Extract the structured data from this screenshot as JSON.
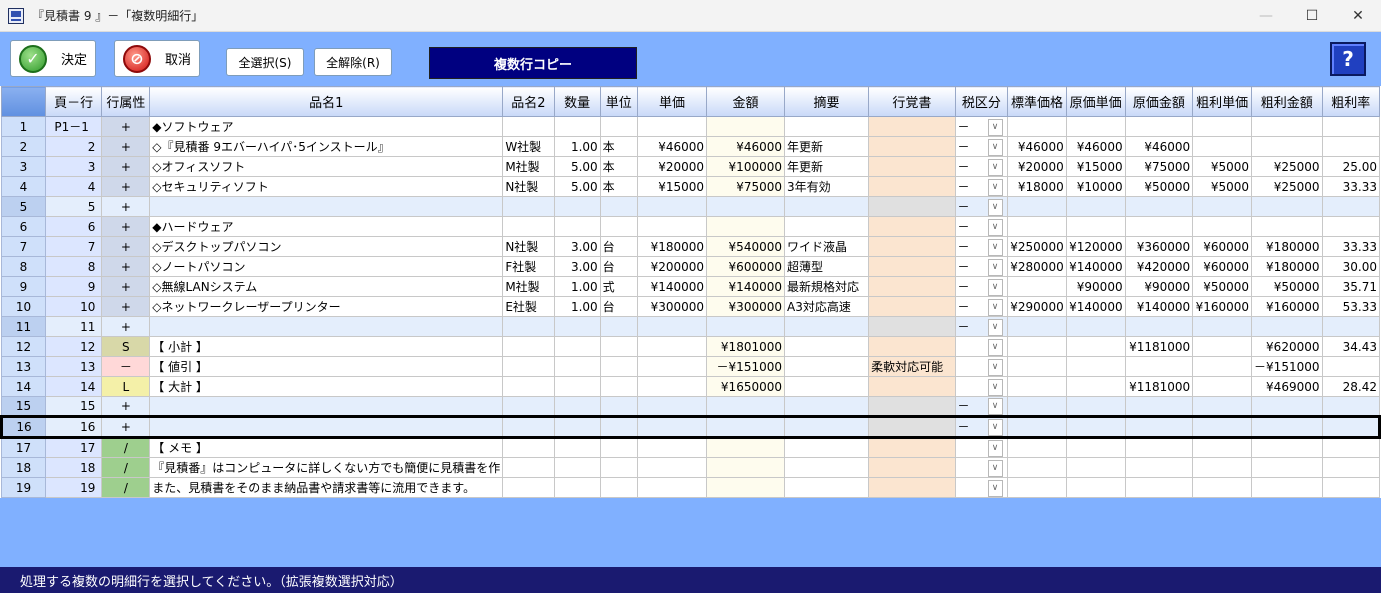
{
  "window": {
    "title": "『見積書 9 』－「複数明細行」",
    "minimize": "—",
    "maximize": "☐",
    "close": "✕"
  },
  "toolbar": {
    "ok_label": "決定",
    "cancel_label": "取消",
    "select_all_label": "全選択(S)",
    "deselect_all_label": "全解除(R)",
    "copy_label": "複数行コピー",
    "help_label": "?"
  },
  "columns": [
    "頁－行",
    "行属性",
    "品名1",
    "品名2",
    "数量",
    "単位",
    "単価",
    "金額",
    "摘要",
    "行覚書",
    "税区分",
    "標準価格",
    "原価単価",
    "原価金額",
    "粗利単価",
    "粗利金額",
    "粗利率"
  ],
  "rows": [
    {
      "n": "1",
      "pg": "P1－1",
      "attr": "+",
      "name1": "◆ソフトウェア",
      "name2": "",
      "qty": "",
      "unit": "",
      "price": "",
      "amount": "",
      "note": "",
      "memo": "",
      "tax": "－",
      "std": "",
      "cost": "",
      "costamt": "",
      "gp": "",
      "gpamt": "",
      "rate": ""
    },
    {
      "n": "2",
      "pg": "2",
      "attr": "+",
      "name1": "◇『見積番 9エバーハイパ･5インストール』",
      "name2": "W社製",
      "qty": "1.00",
      "unit": "本",
      "price": "¥46000",
      "amount": "¥46000",
      "note": "年更新",
      "memo": "",
      "tax": "－",
      "std": "¥46000",
      "cost": "¥46000",
      "costamt": "¥46000",
      "gp": "",
      "gpamt": "",
      "rate": ""
    },
    {
      "n": "3",
      "pg": "3",
      "attr": "+",
      "name1": "◇オフィスソフト",
      "name2": "M社製",
      "qty": "5.00",
      "unit": "本",
      "price": "¥20000",
      "amount": "¥100000",
      "note": "年更新",
      "memo": "",
      "tax": "－",
      "std": "¥20000",
      "cost": "¥15000",
      "costamt": "¥75000",
      "gp": "¥5000",
      "gpamt": "¥25000",
      "rate": "25.00"
    },
    {
      "n": "4",
      "pg": "4",
      "attr": "+",
      "name1": "◇セキュリティソフト",
      "name2": "N社製",
      "qty": "5.00",
      "unit": "本",
      "price": "¥15000",
      "amount": "¥75000",
      "note": "3年有効",
      "memo": "",
      "tax": "－",
      "std": "¥18000",
      "cost": "¥10000",
      "costamt": "¥50000",
      "gp": "¥5000",
      "gpamt": "¥25000",
      "rate": "33.33"
    },
    {
      "n": "5",
      "pg": "5",
      "attr": "+",
      "name1": "",
      "name2": "",
      "qty": "",
      "unit": "",
      "price": "",
      "amount": "",
      "note": "",
      "memo": "",
      "tax": "－",
      "std": "",
      "cost": "",
      "costamt": "",
      "gp": "",
      "gpamt": "",
      "rate": "",
      "blank": true
    },
    {
      "n": "6",
      "pg": "6",
      "attr": "+",
      "name1": "◆ハードウェア",
      "name2": "",
      "qty": "",
      "unit": "",
      "price": "",
      "amount": "",
      "note": "",
      "memo": "",
      "tax": "－",
      "std": "",
      "cost": "",
      "costamt": "",
      "gp": "",
      "gpamt": "",
      "rate": ""
    },
    {
      "n": "7",
      "pg": "7",
      "attr": "+",
      "name1": "◇デスクトップパソコン",
      "name2": "N社製",
      "qty": "3.00",
      "unit": "台",
      "price": "¥180000",
      "amount": "¥540000",
      "note": "ワイド液晶",
      "memo": "",
      "tax": "－",
      "std": "¥250000",
      "cost": "¥120000",
      "costamt": "¥360000",
      "gp": "¥60000",
      "gpamt": "¥180000",
      "rate": "33.33"
    },
    {
      "n": "8",
      "pg": "8",
      "attr": "+",
      "name1": "◇ノートパソコン",
      "name2": "F社製",
      "qty": "3.00",
      "unit": "台",
      "price": "¥200000",
      "amount": "¥600000",
      "note": "超薄型",
      "memo": "",
      "tax": "－",
      "std": "¥280000",
      "cost": "¥140000",
      "costamt": "¥420000",
      "gp": "¥60000",
      "gpamt": "¥180000",
      "rate": "30.00"
    },
    {
      "n": "9",
      "pg": "9",
      "attr": "+",
      "name1": "◇無線LANシステム",
      "name2": "M社製",
      "qty": "1.00",
      "unit": "式",
      "price": "¥140000",
      "amount": "¥140000",
      "note": "最新規格対応",
      "memo": "",
      "tax": "－",
      "std": "",
      "cost": "¥90000",
      "costamt": "¥90000",
      "gp": "¥50000",
      "gpamt": "¥50000",
      "rate": "35.71"
    },
    {
      "n": "10",
      "pg": "10",
      "attr": "+",
      "name1": "◇ネットワークレーザープリンター",
      "name2": "E社製",
      "qty": "1.00",
      "unit": "台",
      "price": "¥300000",
      "amount": "¥300000",
      "note": "A3対応高速",
      "memo": "",
      "tax": "－",
      "std": "¥290000",
      "cost": "¥140000",
      "costamt": "¥140000",
      "gp": "¥160000",
      "gpamt": "¥160000",
      "rate": "53.33"
    },
    {
      "n": "11",
      "pg": "11",
      "attr": "+",
      "name1": "",
      "name2": "",
      "qty": "",
      "unit": "",
      "price": "",
      "amount": "",
      "note": "",
      "memo": "",
      "tax": "－",
      "std": "",
      "cost": "",
      "costamt": "",
      "gp": "",
      "gpamt": "",
      "rate": "",
      "blank": true
    },
    {
      "n": "12",
      "pg": "12",
      "attr": "S",
      "attrc": "S",
      "name1": "【 小計 】",
      "name2": "",
      "qty": "",
      "unit": "",
      "price": "",
      "amount": "¥1801000",
      "note": "",
      "memo": "",
      "tax": "",
      "std": "",
      "cost": "",
      "costamt": "¥1181000",
      "gp": "",
      "gpamt": "¥620000",
      "rate": "34.43"
    },
    {
      "n": "13",
      "pg": "13",
      "attr": "－",
      "attrc": "m",
      "name1": "【 値引 】",
      "name2": "",
      "qty": "",
      "unit": "",
      "price": "",
      "amount": "－¥151000",
      "note": "",
      "memo": "柔軟対応可能",
      "tax": "",
      "std": "",
      "cost": "",
      "costamt": "",
      "gp": "",
      "gpamt": "－¥151000",
      "rate": ""
    },
    {
      "n": "14",
      "pg": "14",
      "attr": "L",
      "attrc": "L",
      "name1": "【 大計 】",
      "name2": "",
      "qty": "",
      "unit": "",
      "price": "",
      "amount": "¥1650000",
      "note": "",
      "memo": "",
      "tax": "",
      "std": "",
      "cost": "",
      "costamt": "¥1181000",
      "gp": "",
      "gpamt": "¥469000",
      "rate": "28.42"
    },
    {
      "n": "15",
      "pg": "15",
      "attr": "+",
      "name1": "",
      "name2": "",
      "qty": "",
      "unit": "",
      "price": "",
      "amount": "",
      "note": "",
      "memo": "",
      "tax": "－",
      "std": "",
      "cost": "",
      "costamt": "",
      "gp": "",
      "gpamt": "",
      "rate": "",
      "blank": true
    },
    {
      "n": "16",
      "pg": "16",
      "attr": "+",
      "name1": "",
      "name2": "",
      "qty": "",
      "unit": "",
      "price": "",
      "amount": "",
      "note": "",
      "memo": "",
      "tax": "－",
      "std": "",
      "cost": "",
      "costamt": "",
      "gp": "",
      "gpamt": "",
      "rate": "",
      "blank": true,
      "selected": true
    },
    {
      "n": "17",
      "pg": "17",
      "attr": "/",
      "attrc": "sl",
      "name1": "【 メモ 】",
      "name2": "",
      "qty": "",
      "unit": "",
      "price": "",
      "amount": "",
      "note": "",
      "memo": "",
      "tax": "",
      "std": "",
      "cost": "",
      "costamt": "",
      "gp": "",
      "gpamt": "",
      "rate": ""
    },
    {
      "n": "18",
      "pg": "18",
      "attr": "/",
      "attrc": "sl",
      "name1": "『見積番』はコンピュータに詳しくない方でも簡便に見積書を作",
      "name2": "",
      "qty": "",
      "unit": "",
      "price": "",
      "amount": "",
      "note": "",
      "memo": "",
      "tax": "",
      "std": "",
      "cost": "",
      "costamt": "",
      "gp": "",
      "gpamt": "",
      "rate": ""
    },
    {
      "n": "19",
      "pg": "19",
      "attr": "/",
      "attrc": "sl",
      "name1": "また、見積書をそのまま納品書や請求書等に流用できます。",
      "name2": "",
      "qty": "",
      "unit": "",
      "price": "",
      "amount": "",
      "note": "",
      "memo": "",
      "tax": "",
      "std": "",
      "cost": "",
      "costamt": "",
      "gp": "",
      "gpamt": "",
      "rate": ""
    }
  ],
  "status": "処理する複数の明細行を選択してください。（拡張複数選択対応）"
}
